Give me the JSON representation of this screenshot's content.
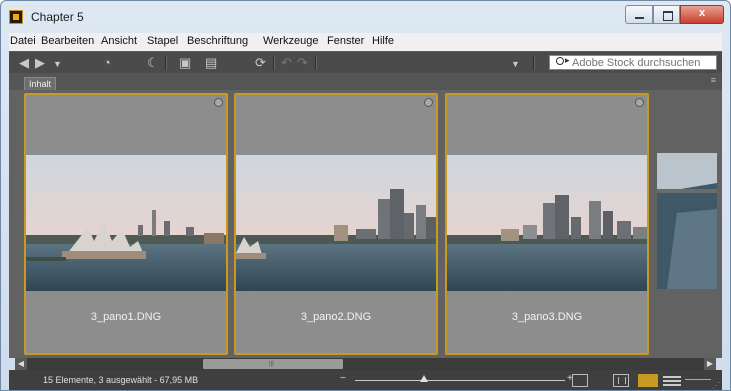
{
  "window": {
    "title": "Chapter 5",
    "controls": {
      "minimize": "minimize",
      "maximize": "maximize",
      "close": "x"
    }
  },
  "menu": [
    "Datei",
    "Bearbeiten",
    "Ansicht",
    "Stapel",
    "Beschriftung",
    "Werkzeuge",
    "Fenster",
    "Hilfe"
  ],
  "toolbar": {
    "icons": [
      "back-arrow-icon",
      "forward-arrow-icon",
      "history-dropdown-icon",
      "reveal-icon",
      "boomerang-icon",
      "get-photos-icon",
      "refine-icon",
      "rotate-icon",
      "undo-icon",
      "redo-icon",
      "sort-dropdown-icon"
    ],
    "search_placeholder": "Adobe Stock durchsuchen"
  },
  "panel": {
    "tab_label": "Inhalt",
    "menu_glyph": "≡"
  },
  "thumbnails": [
    {
      "filename": "3_pano1.DNG",
      "selected": true
    },
    {
      "filename": "3_pano2.DNG",
      "selected": true
    },
    {
      "filename": "3_pano3.DNG",
      "selected": true
    }
  ],
  "status": {
    "text": "15 Elemente, 3 ausgewählt - 67,95 MB",
    "zoom_minus": "−",
    "zoom_plus": "+",
    "zoom_level_fraction": 0.33
  },
  "colors": {
    "selection_border": "#c99a22",
    "toolbar_bg": "#4b4b4b",
    "content_bg": "#626262",
    "card_bg": "#8d8d8d"
  }
}
